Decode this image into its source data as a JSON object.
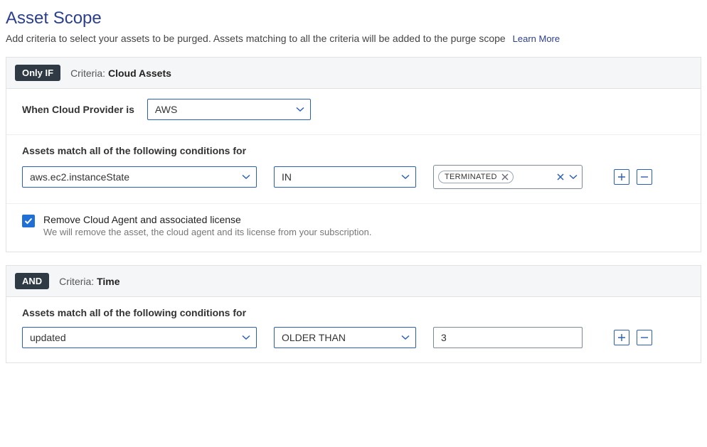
{
  "page": {
    "title": "Asset Scope",
    "description": "Add criteria to select your assets to be purged. Assets matching to all the criteria will be added to the purge scope",
    "learn_more": "Learn More"
  },
  "colors": {
    "accent": "#2b5fb3",
    "heading": "#2b3f8f",
    "badge_bg": "#303a44"
  },
  "blocks": [
    {
      "badge": "Only IF",
      "criteria_prefix": "Criteria:",
      "criteria_name": "Cloud Assets",
      "provider": {
        "label": "When Cloud Provider is",
        "value": "AWS"
      },
      "conditions_title": "Assets match all of the following conditions for",
      "conditions": [
        {
          "field": "aws.ec2.instanceState",
          "operator": "IN",
          "tags": [
            "TERMINATED"
          ]
        }
      ],
      "remove_agent": {
        "checked": true,
        "label": "Remove Cloud Agent and associated license",
        "sub": "We will remove the asset, the cloud agent and its license from your subscription."
      }
    },
    {
      "badge": "AND",
      "criteria_prefix": "Criteria:",
      "criteria_name": "Time",
      "conditions_title": "Assets match all of the following conditions for",
      "conditions": [
        {
          "field": "updated",
          "operator": "OLDER THAN",
          "value": "3"
        }
      ]
    }
  ]
}
